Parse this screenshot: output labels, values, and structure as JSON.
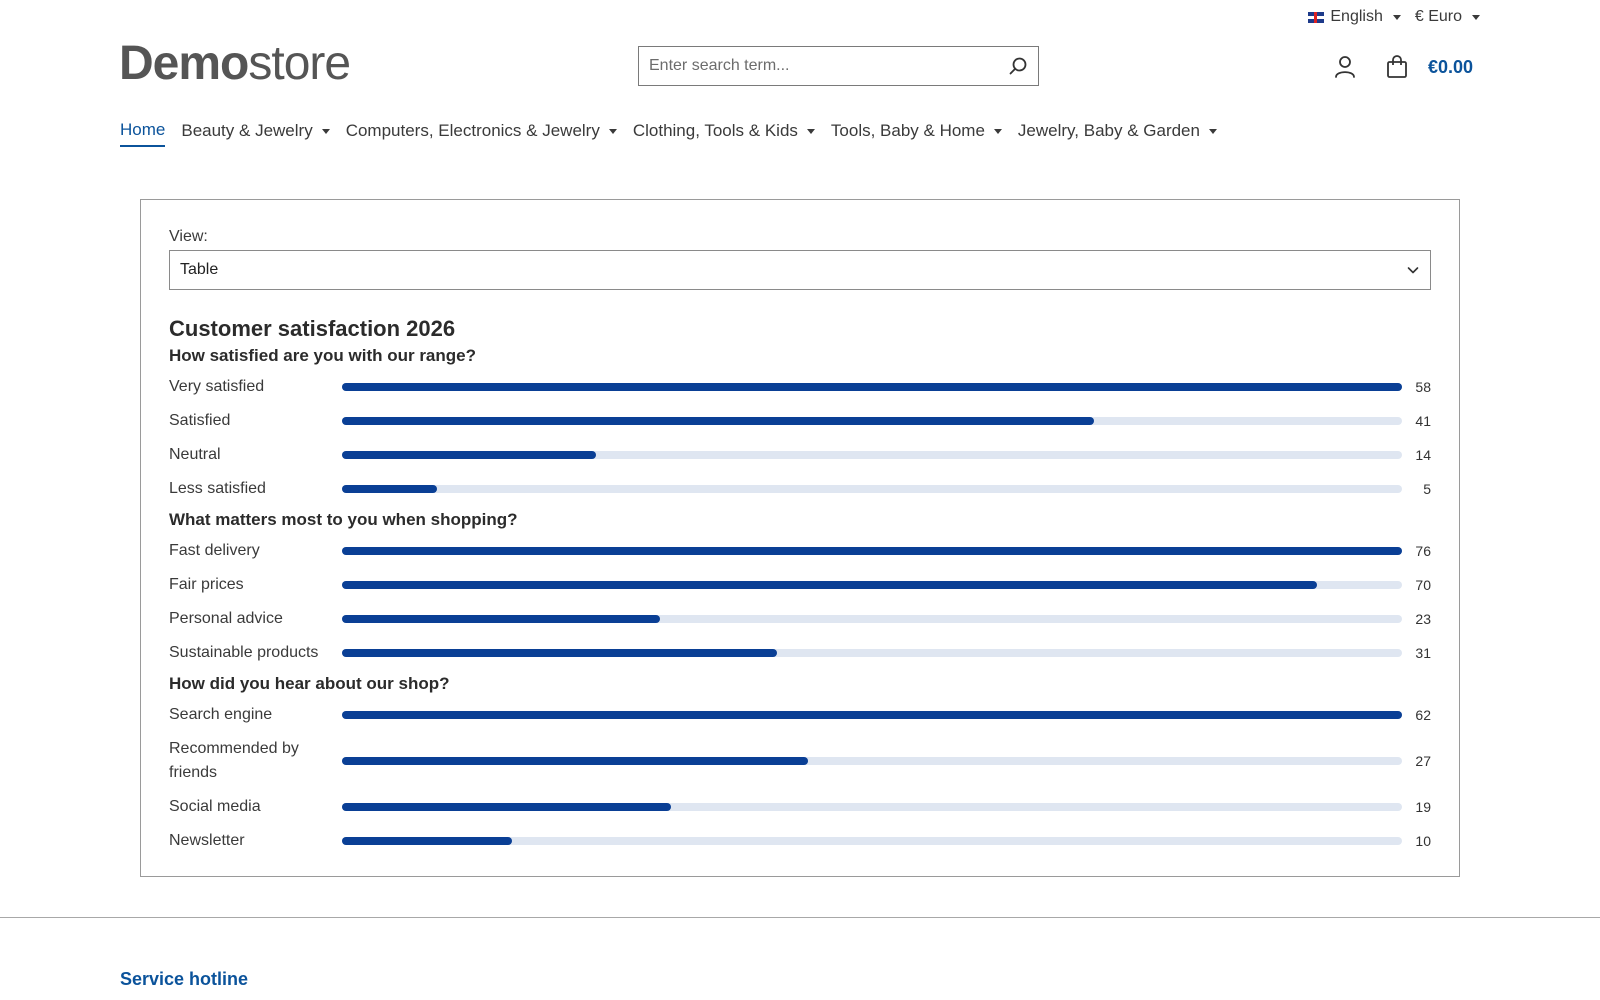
{
  "topbar": {
    "language": "English",
    "currency": "€ Euro"
  },
  "logo": {
    "bold": "Demo",
    "light": "store"
  },
  "search": {
    "placeholder": "Enter search term..."
  },
  "header": {
    "cart_total": "€0.00"
  },
  "nav": [
    {
      "label": "Home",
      "active": true
    },
    {
      "label": "Beauty & Jewelry"
    },
    {
      "label": "Computers, Electronics & Jewelry"
    },
    {
      "label": "Clothing, Tools & Kids"
    },
    {
      "label": "Tools, Baby & Home"
    },
    {
      "label": "Jewelry, Baby & Garden"
    }
  ],
  "view": {
    "label": "View:",
    "selected": "Table"
  },
  "survey": {
    "title": "Customer satisfaction 2026",
    "questions": [
      {
        "title": "How satisfied are you with our range?",
        "answers": [
          {
            "label": "Very satisfied",
            "value": "58",
            "fill": 1.0
          },
          {
            "label": "Satisfied",
            "value": "41",
            "fill": 0.709
          },
          {
            "label": "Neutral",
            "value": "14",
            "fill": 0.24
          },
          {
            "label": "Less satisfied",
            "value": "5",
            "fill": 0.09
          }
        ]
      },
      {
        "title": "What matters most to you when shopping?",
        "answers": [
          {
            "label": "Fast delivery",
            "value": "76",
            "fill": 1.0
          },
          {
            "label": "Fair prices",
            "value": "70",
            "fill": 0.92
          },
          {
            "label": "Personal advice",
            "value": "23",
            "fill": 0.3
          },
          {
            "label": "Sustainable products",
            "value": "31",
            "fill": 0.41
          }
        ]
      },
      {
        "title": "How did you hear about our shop?",
        "answers": [
          {
            "label": "Search engine",
            "value": "62",
            "fill": 1.0
          },
          {
            "label": "Recommended by friends",
            "value": "27",
            "fill": 0.44
          },
          {
            "label": "Social media",
            "value": "19",
            "fill": 0.31
          },
          {
            "label": "Newsletter",
            "value": "10",
            "fill": 0.16
          }
        ]
      }
    ]
  },
  "footer": {
    "title": "Service hotline"
  },
  "colors": {
    "accent": "#0b539b",
    "bar": "#0a3f95",
    "track": "#dfe6f1"
  },
  "icons": {
    "search": "search-icon",
    "account": "user-icon",
    "cart": "shopping-bag-icon",
    "select": "chevron-down-icon"
  }
}
